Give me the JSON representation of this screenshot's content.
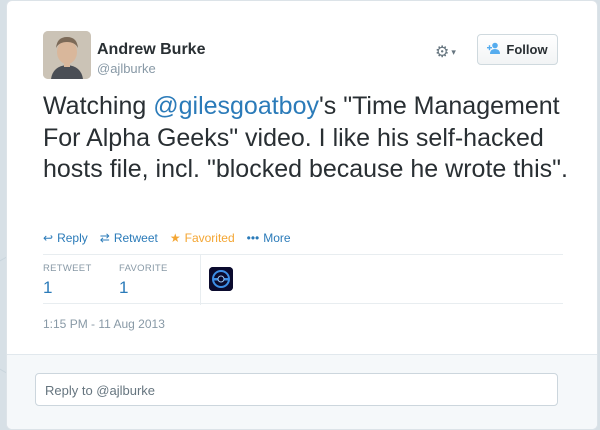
{
  "author": {
    "name": "Andrew Burke",
    "handle": "@ajlburke"
  },
  "header": {
    "gear_chevron": "▾",
    "follow_label": "Follow"
  },
  "tweet": {
    "text_before": "Watching ",
    "mention": "@gilesgoatboy",
    "text_after": "'s \"Time Management For Alpha Geeks\" video. I like his self-hacked hosts file, incl. \"blocked because he wrote this\"."
  },
  "actions": [
    {
      "label": "Reply",
      "icon": "reply-icon",
      "glyph": "↩"
    },
    {
      "label": "Retweet",
      "icon": "retweet-icon",
      "glyph": "⇄"
    },
    {
      "label": "Favorited",
      "icon": "star-icon",
      "glyph": "★"
    },
    {
      "label": "More",
      "icon": "more-icon",
      "glyph": "•••"
    }
  ],
  "stats": {
    "retweet_label": "RETWEET",
    "retweet_count": "1",
    "favorite_label": "FAVORITE",
    "favorite_count": "1"
  },
  "timestamp": "1:15 PM - 11 Aug 2013",
  "reply": {
    "placeholder": "Reply to @ajlburke"
  },
  "colors": {
    "link": "#2b7bb9",
    "favorite": "#f4a633",
    "muted": "#8899a6"
  }
}
